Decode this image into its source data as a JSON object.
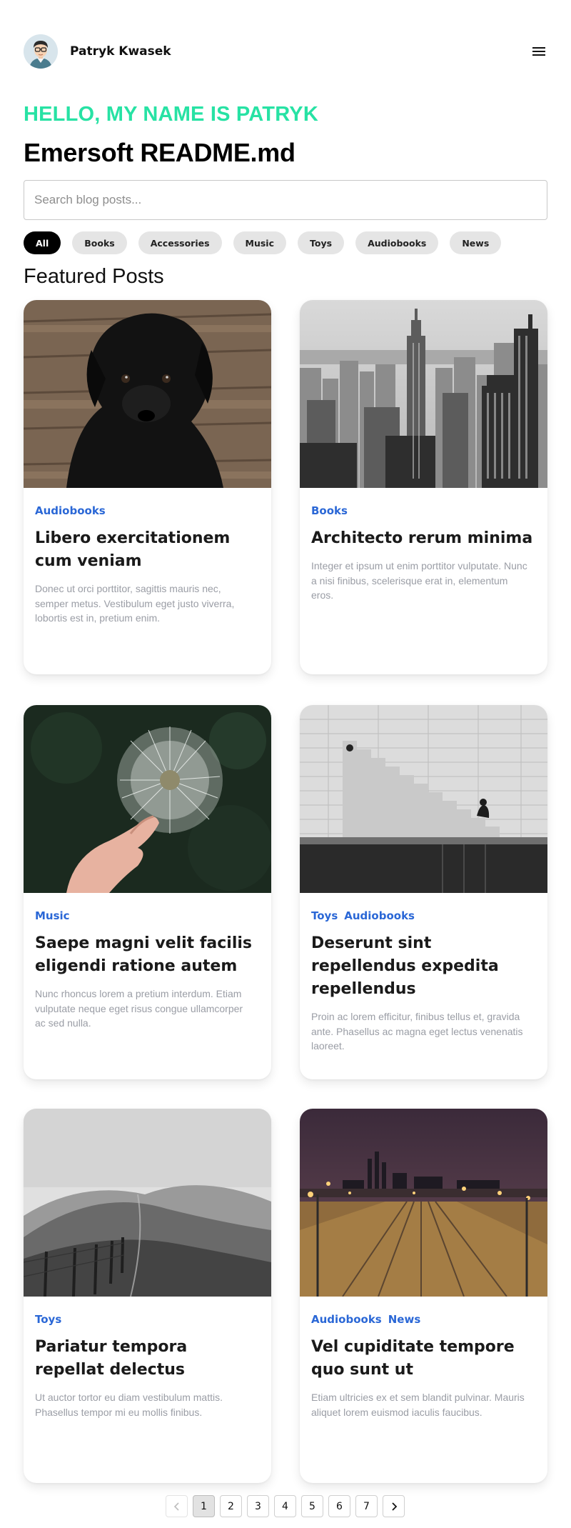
{
  "header": {
    "author_name": "Patryk Kwasek",
    "avatar_icon": "avatar-illustration",
    "menu_icon": "hamburger-menu-icon"
  },
  "hero": {
    "greeting": "HELLO, MY NAME IS PATRYK",
    "title": "Emersoft README.md",
    "greeting_color": "#27e2a4"
  },
  "search": {
    "placeholder": "Search blog posts...",
    "value": ""
  },
  "filters": [
    {
      "label": "All",
      "active": true
    },
    {
      "label": "Books",
      "active": false
    },
    {
      "label": "Accessories",
      "active": false
    },
    {
      "label": "Music",
      "active": false
    },
    {
      "label": "Toys",
      "active": false
    },
    {
      "label": "Audiobooks",
      "active": false
    },
    {
      "label": "News",
      "active": false
    }
  ],
  "section": {
    "title": "Featured Posts"
  },
  "posts": [
    {
      "image": "black-puppy-on-wood-photo",
      "tags": [
        "Audiobooks"
      ],
      "title": "Libero exercitationem cum veniam",
      "excerpt": "Donec ut orci porttitor, sagittis mauris nec, semper metus. Vestibulum eget justo viverra, lobortis est in, pretium enim."
    },
    {
      "image": "city-skyline-bw-photo",
      "tags": [
        "Books"
      ],
      "title": "Architecto rerum minima",
      "excerpt": "Integer et ipsum ut enim porttitor vulputate. Nunc a nisi finibus, scelerisque erat in, elementum eros."
    },
    {
      "image": "dandelion-in-hand-photo",
      "tags": [
        "Music"
      ],
      "title": "Saepe magni velit facilis eligendi ratione autem",
      "excerpt": "Nunc rhoncus lorem a pretium interdum. Etiam vulputate neque eget risus congue ullamcorper ac sed nulla."
    },
    {
      "image": "stone-stairs-bw-photo",
      "tags": [
        "Toys",
        "Audiobooks"
      ],
      "title": "Deserunt sint repellendus expedita repellendus",
      "excerpt": "Proin ac lorem efficitur, finibus tellus et, gravida ante. Phasellus ac magna eget lectus venenatis laoreet."
    },
    {
      "image": "hills-fence-bw-photo",
      "tags": [
        "Toys"
      ],
      "title": "Pariatur tempora repellat delectus",
      "excerpt": "Ut auctor tortor eu diam vestibulum mattis. Phasellus tempor mi eu mollis finibus."
    },
    {
      "image": "railway-night-city-photo",
      "tags": [
        "Audiobooks",
        "News"
      ],
      "title": "Vel cupiditate tempore quo sunt ut",
      "excerpt": "Etiam ultricies ex et sem blandit pulvinar. Mauris aliquet lorem euismod iaculis faucibus."
    }
  ],
  "pagination": {
    "prev_icon": "chevron-left-icon",
    "next_icon": "chevron-right-icon",
    "pages": [
      "1",
      "2",
      "3",
      "4",
      "5",
      "6",
      "7"
    ],
    "current": "1"
  },
  "colors": {
    "tag": "#2a67d6",
    "excerpt": "#9a9da5",
    "chip_bg": "#e5e5e5",
    "chip_active_bg": "#000000"
  }
}
